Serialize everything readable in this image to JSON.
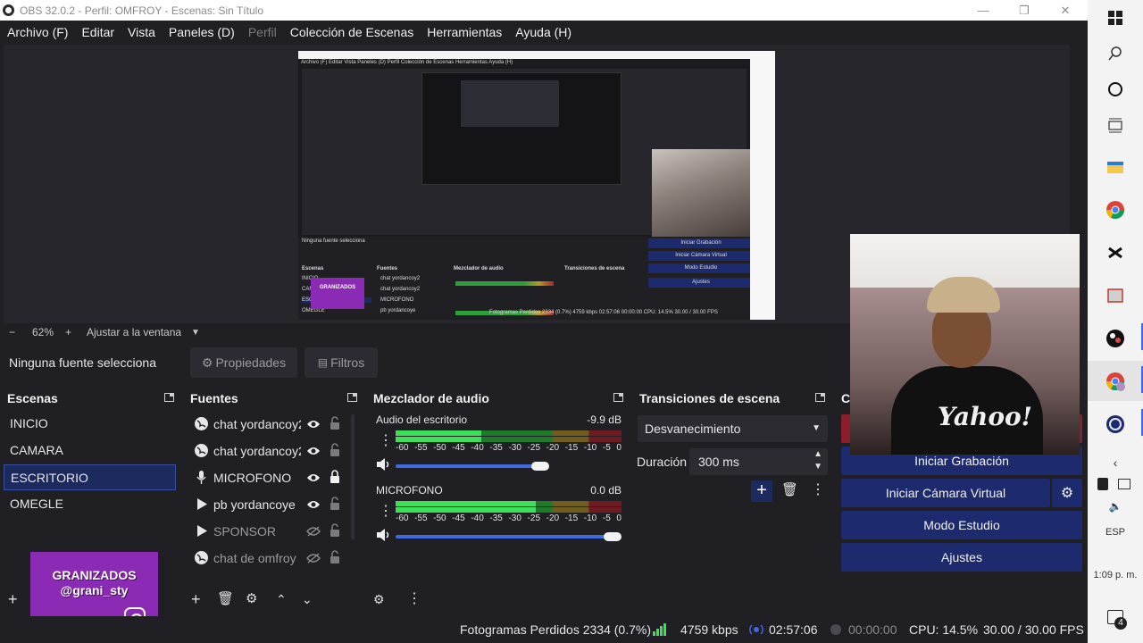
{
  "window": {
    "title": "OBS 32.0.2 - Perfil: OMFROY - Escenas: Sin Título",
    "minimize": "—",
    "maximize": "❐",
    "close": "✕"
  },
  "menu": [
    "Archivo (F)",
    "Editar",
    "Vista",
    "Paneles (D)",
    "Perfil",
    "Colección de Escenas",
    "Herramientas",
    "Ayuda (H)"
  ],
  "zoom": {
    "minus": "−",
    "value": "62%",
    "plus": "+",
    "fit": "Ajustar a la ventana",
    "dropdown": "▼"
  },
  "source_bar": {
    "none_selected": "Ninguna fuente selecciona",
    "properties": "Propiedades",
    "filters": "Filtros"
  },
  "scenes": {
    "title": "Escenas",
    "items": [
      "INICIO",
      "CAMARA",
      "ESCRITORIO",
      "OMEGLE"
    ],
    "selected": "ESCRITORIO"
  },
  "sources": {
    "title": "Fuentes",
    "items": [
      {
        "label": "chat yordancoy2",
        "icon": "globe-icon",
        "visible": true,
        "locked": false,
        "dim": false
      },
      {
        "label": "chat yordancoy2",
        "icon": "globe-icon",
        "visible": true,
        "locked": false,
        "dim": false
      },
      {
        "label": "MICROFONO",
        "icon": "microphone-icon",
        "visible": true,
        "locked": true,
        "dim": false
      },
      {
        "label": "pb yordancoye",
        "icon": "play-icon",
        "visible": true,
        "locked": false,
        "dim": false
      },
      {
        "label": "SPONSOR",
        "icon": "play-icon",
        "visible": false,
        "locked": false,
        "dim": true
      },
      {
        "label": "chat de omfroy",
        "icon": "globe-icon",
        "visible": false,
        "locked": false,
        "dim": true
      }
    ]
  },
  "mixer": {
    "title": "Mezclador de audio",
    "channels": [
      {
        "name": "Audio del escritorio",
        "db": "-9.9 dB",
        "level": 0.38,
        "volume": 0.64
      },
      {
        "name": "MICROFONO",
        "db": "0.0 dB",
        "level": 0.62,
        "volume": 0.96
      }
    ],
    "ticks": [
      "-60",
      "-55",
      "-50",
      "-45",
      "-40",
      "-35",
      "-30",
      "-25",
      "-20",
      "-15",
      "-10",
      "-5",
      "0"
    ]
  },
  "transitions": {
    "title": "Transiciones de escena",
    "selected": "Desvanecimiento",
    "duration_label": "Duración",
    "duration_value": "300 ms"
  },
  "controls": {
    "title": "C",
    "start_recording": "Iniciar Grabación",
    "start_virtual_cam": "Iniciar Cámara Virtual",
    "studio_mode": "Modo Estudio",
    "settings": "Ajustes"
  },
  "status": {
    "dropped_frames": "Fotogramas Perdidos 2334 (0.7%)",
    "bitrate": "4759 kbps",
    "stream_time": "02:57:06",
    "record_time": "00:00:00",
    "cpu": "CPU: 14.5%",
    "fps": "30.00 / 30.00 FPS"
  },
  "overlay": {
    "line1": "GRANIZADOS",
    "line2": "@grani_sty"
  },
  "webcam_logo": "Yahoo!",
  "nested_preview": {
    "menu": "Archivo (F)   Editar   Vista   Paneles (D)   Perfil   Colección de Escenas   Herramientas   Ayuda (H)",
    "no_source": "Ninguna fuente selecciona",
    "scenes_title": "Escenas",
    "sources_title": "Fuentes",
    "mixer_title": "Mezclador de audio",
    "transitions_title": "Transiciones de escena",
    "btn1": "Iniciar Grabación",
    "btn2": "Iniciar Cámara Virtual",
    "btn3": "Modo Estudio",
    "btn4": "Ajustes",
    "status": "Fotogramas Perdidos 2334 (0.7%)    4759 kbps    02:57:06    00:00:00    CPU: 14.5%    30.00 / 30.00 FPS"
  },
  "taskbar": {
    "lang": "ESP",
    "time": "1:09 p. m.",
    "notifications": "4"
  },
  "colors": {
    "bg": "#1f1f24",
    "panel": "#1b1b1f",
    "accent": "#1d2b6e",
    "selection": "#1c2a5e",
    "meter_green": "#3ee05a",
    "overlay_purple": "#8b2ab5"
  }
}
